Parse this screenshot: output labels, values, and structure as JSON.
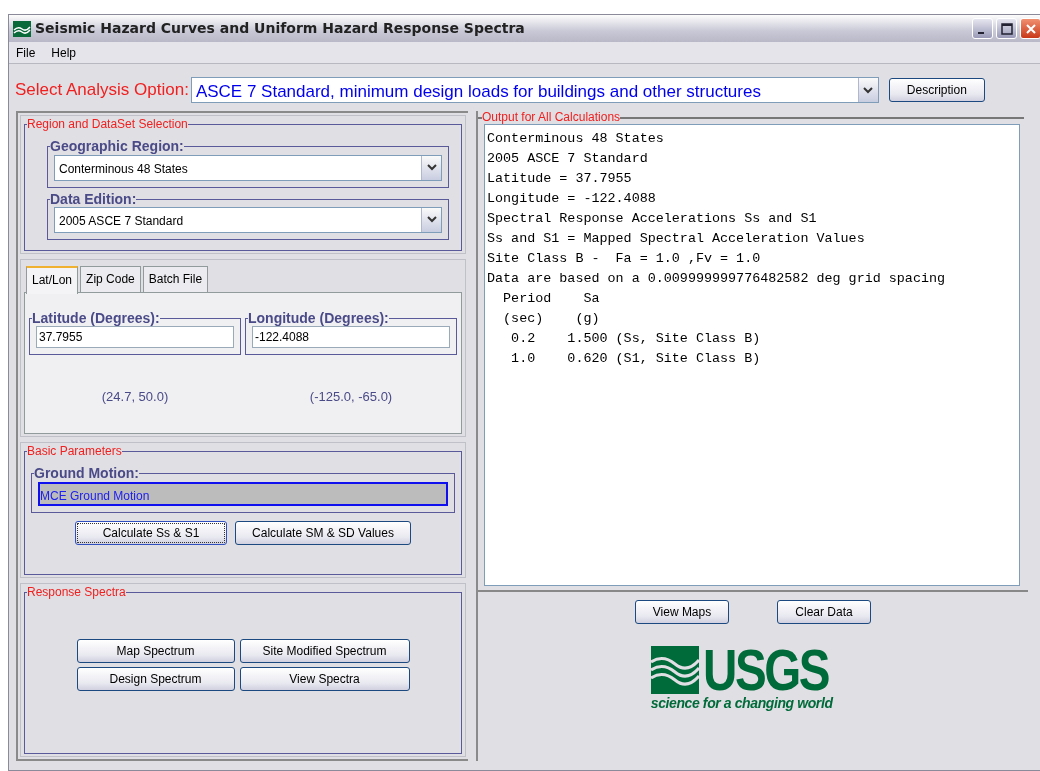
{
  "window": {
    "title": "Seismic Hazard Curves and Uniform Hazard Response Spectra"
  },
  "menu": [
    "File",
    "Help"
  ],
  "analysis": {
    "label": "Select Analysis Option:",
    "value": "ASCE 7 Standard, minimum design loads for buildings and other structures",
    "button": "Description"
  },
  "region_panel": {
    "title": "Region and DataSet Selection",
    "fields": [
      {
        "label": "Geographic Region:",
        "value": "Conterminous 48 States"
      },
      {
        "label": "Data Edition:",
        "value": "2005 ASCE 7 Standard"
      }
    ]
  },
  "location_tabs": [
    {
      "label": "Lat/Lon",
      "selected": true
    },
    {
      "label": "Zip Code",
      "selected": false
    },
    {
      "label": "Batch File",
      "selected": false
    }
  ],
  "coordinates": [
    {
      "label": "Latitude (Degrees):",
      "value": "37.7955",
      "range": "(24.7, 50.0)"
    },
    {
      "label": "Longitude (Degrees):",
      "value": "-122.4088",
      "range": "(-125.0, -65.0)"
    }
  ],
  "basic_parameters": {
    "title": "Basic Parameters",
    "field_label": "Ground Motion:",
    "value": "MCE Ground Motion",
    "buttons": [
      {
        "label": "Calculate Ss & S1",
        "focused": true
      },
      {
        "label": "Calculate SM & SD Values",
        "focused": false
      }
    ]
  },
  "response_spectra": {
    "title": "Response Spectra",
    "buttons": [
      "Map Spectrum",
      "Site Modified Spectrum",
      "Design Spectrum",
      "View Spectra"
    ]
  },
  "output": {
    "title": "Output for All Calculations",
    "lines": [
      "Conterminous 48 States",
      "2005 ASCE 7 Standard",
      "Latitude = 37.7955",
      "Longitude = -122.4088",
      "Spectral Response Accelerations Ss and S1",
      "Ss and S1 = Mapped Spectral Acceleration Values",
      "Site Class B -  Fa = 1.0 ,Fv = 1.0",
      "Data are based on a 0.009999999776482582 deg grid spacing",
      "  Period    Sa",
      "  (sec)    (g)",
      "   0.2    1.500 (Ss, Site Class B)",
      "   1.0    0.620 (S1, Site Class B)"
    ]
  },
  "output_buttons": [
    "View Maps",
    "Clear Data"
  ],
  "logo": {
    "wordmark": "USGS",
    "tagline": "science for a changing world"
  }
}
